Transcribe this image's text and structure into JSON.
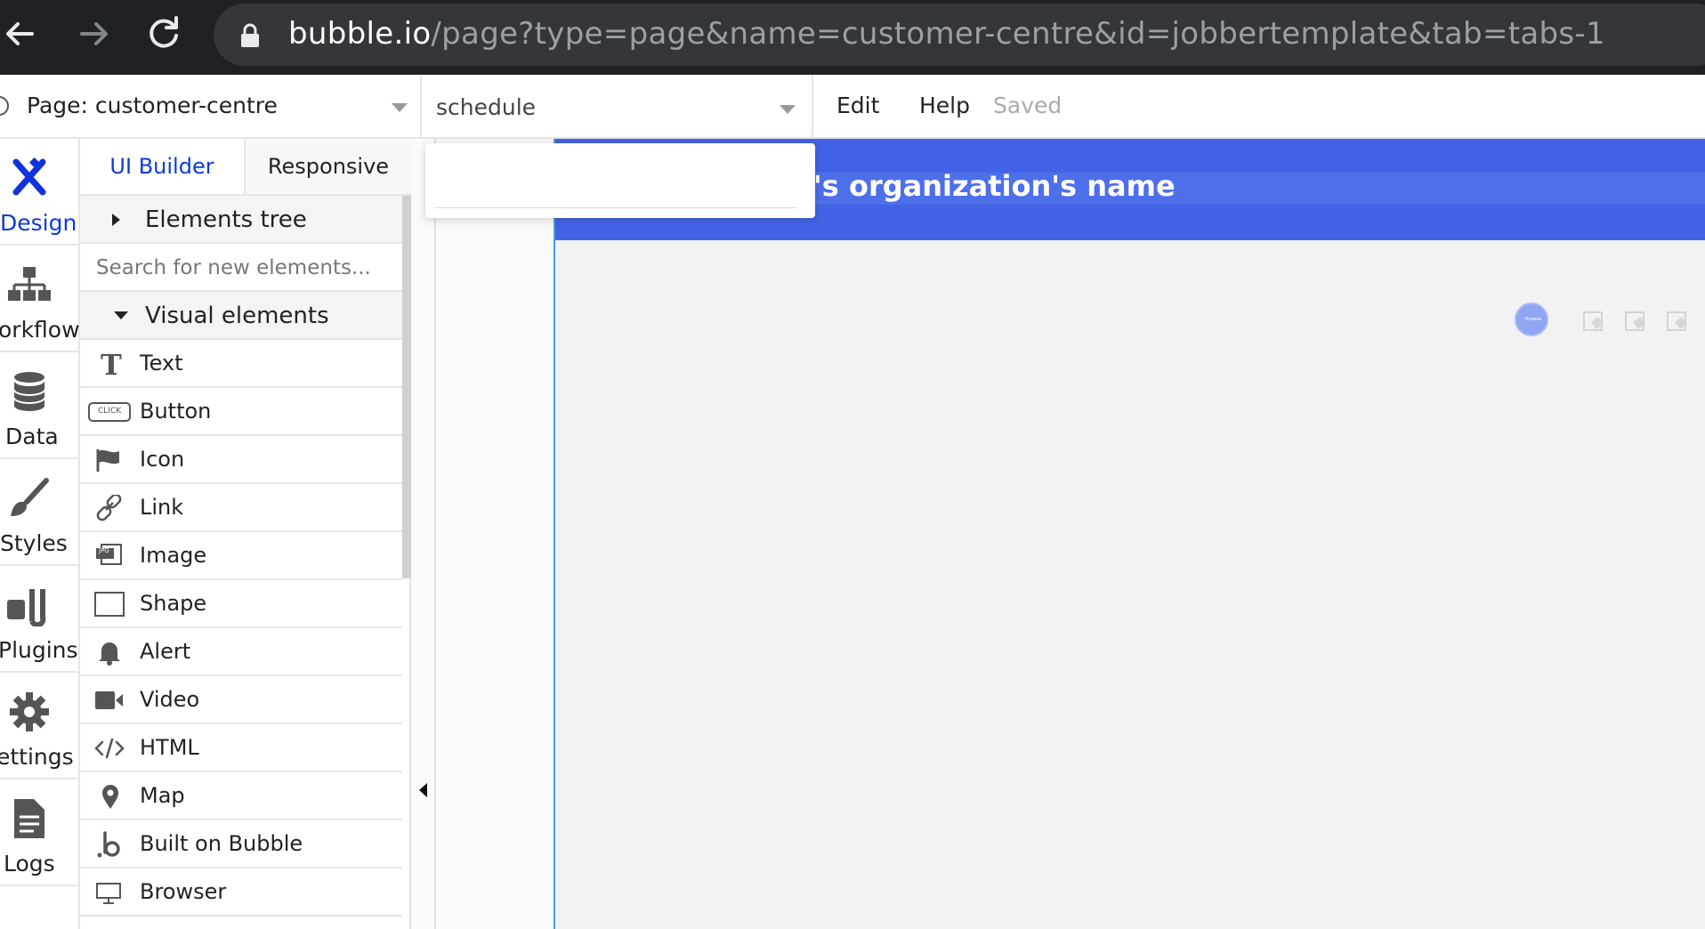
{
  "browser": {
    "url_host": "bubble.io",
    "url_path": "/page?type=page&name=customer-centre&id=jobbertemplate&tab=tabs-1"
  },
  "toolbar": {
    "page_label": "Page: customer-centre",
    "element_label": "schedule",
    "edit_label": "Edit",
    "help_label": "Help",
    "saved_label": "Saved"
  },
  "tabs": [
    {
      "label": "Design",
      "icon": "design-icon",
      "active": true
    },
    {
      "label": "orkflow",
      "icon": "workflow-icon"
    },
    {
      "label": "Data",
      "icon": "database-icon"
    },
    {
      "label": "Styles",
      "icon": "brush-icon"
    },
    {
      "label": "Plugins",
      "icon": "plug-icon"
    },
    {
      "label": "ettings",
      "icon": "gear-icon"
    },
    {
      "label": "Logs",
      "icon": "document-icon"
    }
  ],
  "panel": {
    "ui_builder_label": "UI Builder",
    "responsive_label": "Responsive",
    "elements_tree_label": "Elements tree",
    "search_placeholder": "Search for new elements...",
    "visual_elements_label": "Visual elements",
    "items": [
      {
        "label": "Text",
        "icon": "text-icon"
      },
      {
        "label": "Button",
        "icon": "button-icon"
      },
      {
        "label": "Icon",
        "icon": "flag-icon"
      },
      {
        "label": "Link",
        "icon": "link-icon"
      },
      {
        "label": "Image",
        "icon": "image-icon"
      },
      {
        "label": "Shape",
        "icon": "shape-icon"
      },
      {
        "label": "Alert",
        "icon": "bell-icon"
      },
      {
        "label": "Video",
        "icon": "video-icon"
      },
      {
        "label": "HTML",
        "icon": "code-icon"
      },
      {
        "label": "Map",
        "icon": "map-pin-icon"
      },
      {
        "label": "Built on Bubble",
        "icon": "bubble-logo-icon"
      },
      {
        "label": "Browser",
        "icon": "monitor-icon"
      }
    ],
    "button_icon_text": "CLICK",
    "image_icon_text": "JPG"
  },
  "canvas": {
    "header_title": "'s organization's name",
    "header_color": "#4363e6",
    "avatar_text": "Browse"
  },
  "colors": {
    "accent": "#0d3bd6",
    "header": "#4363e6",
    "page_border": "#4b9be5"
  }
}
